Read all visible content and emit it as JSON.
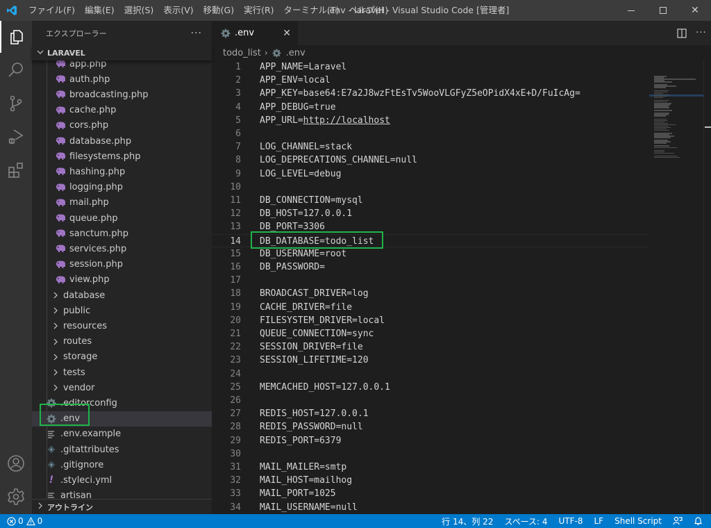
{
  "window": {
    "title": ".env - laravel - Visual Studio Code [管理者]",
    "menu": [
      "ファイル(F)",
      "編集(E)",
      "選択(S)",
      "表示(V)",
      "移動(G)",
      "実行(R)",
      "ターミナル(T)",
      "ヘルプ(H)"
    ],
    "controls": {
      "minimize": "—",
      "maximize": "☐",
      "close": "✕"
    }
  },
  "activity_bar": {
    "items": [
      "explorer-icon",
      "search-icon",
      "source-control-icon",
      "run-debug-icon",
      "extensions-icon"
    ],
    "bottom": [
      "accounts-icon",
      "manage-gear-icon"
    ]
  },
  "sidebar": {
    "title": "エクスプローラー",
    "more": "···",
    "root": "LARAVEL",
    "items": [
      {
        "label": "app.php",
        "type": "php",
        "depth": 2
      },
      {
        "label": "auth.php",
        "type": "php",
        "depth": 2
      },
      {
        "label": "broadcasting.php",
        "type": "php",
        "depth": 2
      },
      {
        "label": "cache.php",
        "type": "php",
        "depth": 2
      },
      {
        "label": "cors.php",
        "type": "php",
        "depth": 2
      },
      {
        "label": "database.php",
        "type": "php",
        "depth": 2
      },
      {
        "label": "filesystems.php",
        "type": "php",
        "depth": 2
      },
      {
        "label": "hashing.php",
        "type": "php",
        "depth": 2
      },
      {
        "label": "logging.php",
        "type": "php",
        "depth": 2
      },
      {
        "label": "mail.php",
        "type": "php",
        "depth": 2
      },
      {
        "label": "queue.php",
        "type": "php",
        "depth": 2
      },
      {
        "label": "sanctum.php",
        "type": "php",
        "depth": 2
      },
      {
        "label": "services.php",
        "type": "php",
        "depth": 2
      },
      {
        "label": "session.php",
        "type": "php",
        "depth": 2
      },
      {
        "label": "view.php",
        "type": "php",
        "depth": 2
      },
      {
        "label": "database",
        "type": "folder",
        "depth": 1
      },
      {
        "label": "public",
        "type": "folder",
        "depth": 1
      },
      {
        "label": "resources",
        "type": "folder",
        "depth": 1
      },
      {
        "label": "routes",
        "type": "folder",
        "depth": 1
      },
      {
        "label": "storage",
        "type": "folder",
        "depth": 1
      },
      {
        "label": "tests",
        "type": "folder",
        "depth": 1
      },
      {
        "label": "vendor",
        "type": "folder",
        "depth": 1
      },
      {
        "label": ".editorconfig",
        "type": "gear",
        "depth": 1
      },
      {
        "label": ".env",
        "type": "gear",
        "depth": 1,
        "selected": true
      },
      {
        "label": ".env.example",
        "type": "lines",
        "depth": 1
      },
      {
        "label": ".gitattributes",
        "type": "git",
        "depth": 1
      },
      {
        "label": ".gitignore",
        "type": "git",
        "depth": 1
      },
      {
        "label": ".styleci.yml",
        "type": "yml",
        "depth": 1
      },
      {
        "label": "artisan",
        "type": "lines",
        "depth": 1
      }
    ],
    "outline": "アウトライン"
  },
  "editor": {
    "tab": {
      "label": ".env",
      "close": "✕"
    },
    "breadcrumbs": [
      "todo_list",
      ".env"
    ],
    "current_line": 14,
    "lines": [
      "APP_NAME=Laravel",
      "APP_ENV=local",
      "APP_KEY=base64:E7a2J8wzFtEsTv5WooVLGFyZ5eOPidX4xE+D/FuIcAg=",
      "APP_DEBUG=true",
      "APP_URL=http://localhost",
      "",
      "LOG_CHANNEL=stack",
      "LOG_DEPRECATIONS_CHANNEL=null",
      "LOG_LEVEL=debug",
      "",
      "DB_CONNECTION=mysql",
      "DB_HOST=127.0.0.1",
      "DB_PORT=3306",
      "DB_DATABASE=todo_list",
      "DB_USERNAME=root",
      "DB_PASSWORD=",
      "",
      "BROADCAST_DRIVER=log",
      "CACHE_DRIVER=file",
      "FILESYSTEM_DRIVER=local",
      "QUEUE_CONNECTION=sync",
      "SESSION_DRIVER=file",
      "SESSION_LIFETIME=120",
      "",
      "MEMCACHED_HOST=127.0.0.1",
      "",
      "REDIS_HOST=127.0.0.1",
      "REDIS_PASSWORD=null",
      "REDIS_PORT=6379",
      "",
      "MAIL_MAILER=smtp",
      "MAIL_HOST=mailhog",
      "MAIL_PORT=1025",
      "MAIL_USERNAME=null"
    ]
  },
  "statusbar": {
    "errors": "0",
    "warnings": "0",
    "position": "行 14、列 22",
    "indent": "スペース: 4",
    "encoding": "UTF-8",
    "eol": "LF",
    "language": "Shell Script"
  },
  "colors": {
    "accent": "#007acc",
    "highlight_box": "#1fb44a",
    "php_icon": "#a074c4"
  }
}
